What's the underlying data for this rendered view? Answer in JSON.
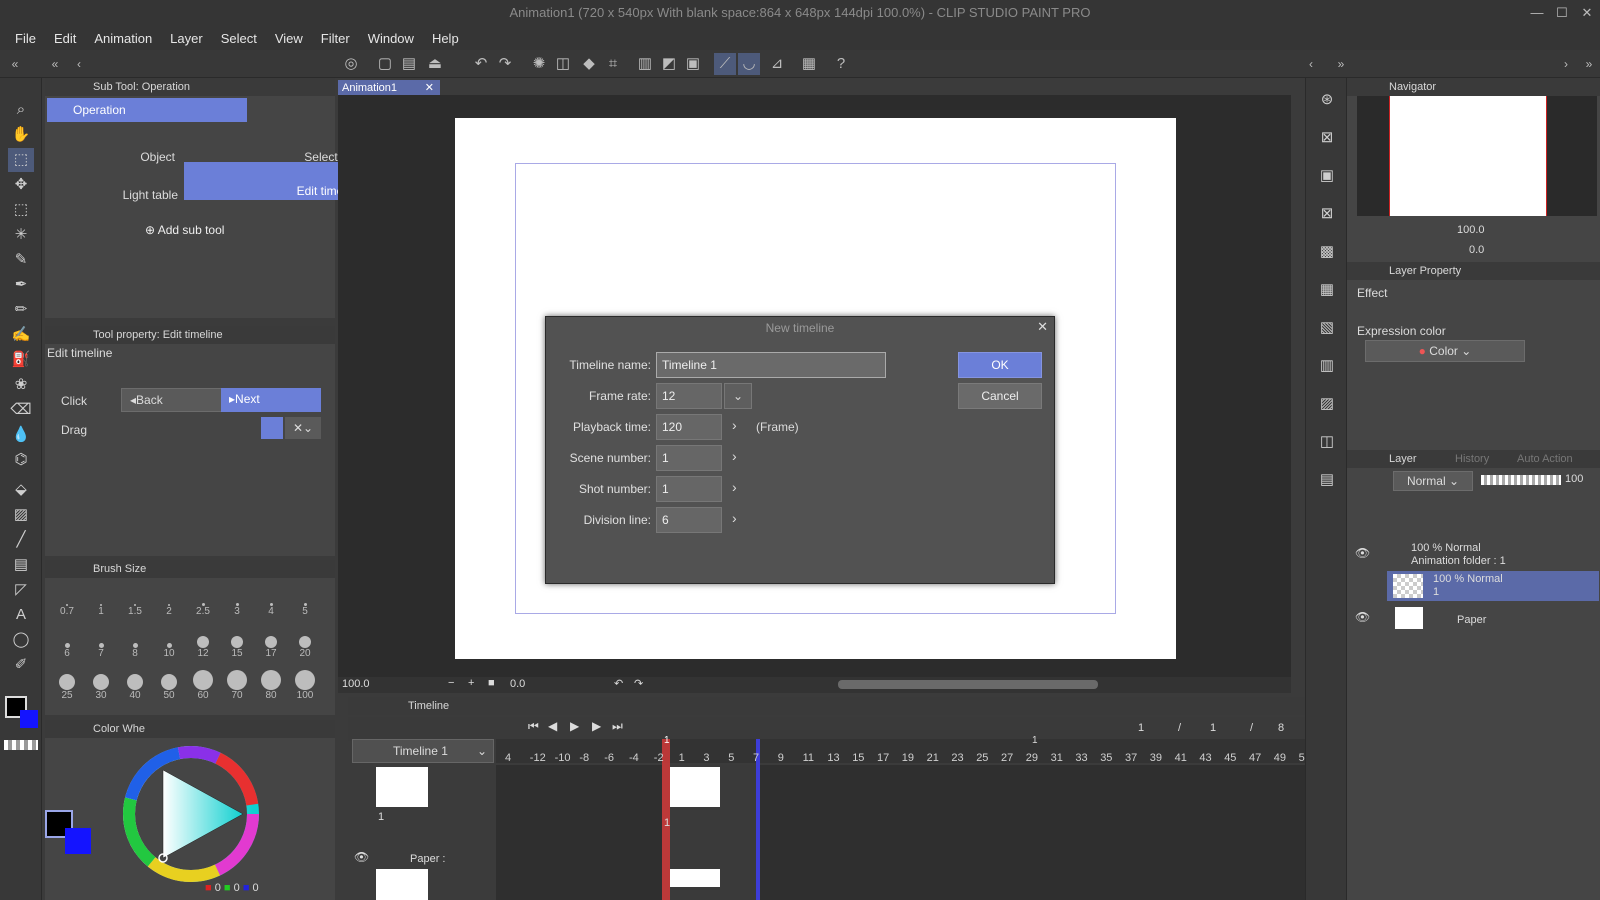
{
  "window": {
    "title": "Animation1 (720 x 540px With blank space:864 x 648px 144dpi 100.0%)  - CLIP STUDIO PAINT PRO",
    "minimize": "—",
    "maximize": "☐",
    "close": "✕"
  },
  "menu": [
    "File",
    "Edit",
    "Animation",
    "Layer",
    "Select",
    "View",
    "Filter",
    "Window",
    "Help"
  ],
  "subtool": {
    "header": "Sub Tool: Operation",
    "group_tab": "Operation",
    "items": [
      "Object",
      "Select layer",
      "Light table",
      "Edit timeline"
    ],
    "add_label": "Add sub tool"
  },
  "tool_property": {
    "header": "Tool property: Edit timeline",
    "name": "Edit timeline",
    "click_label": "Click",
    "back_label": "Back",
    "next_label": "Next",
    "drag_label": "Drag"
  },
  "brush_size": {
    "header": "Brush Size",
    "rows": [
      [
        "0.7",
        "1",
        "1.5",
        "2",
        "2.5",
        "3",
        "4",
        "5"
      ],
      [
        "6",
        "7",
        "8",
        "10",
        "12",
        "15",
        "17",
        "20"
      ],
      [
        "25",
        "30",
        "40",
        "50",
        "60",
        "70",
        "80",
        "100"
      ]
    ]
  },
  "color_wheel": {
    "header": "Color Whe",
    "r": "0",
    "g": "0",
    "b": "0"
  },
  "canvas": {
    "tab": "Animation1",
    "zoom": "100.0",
    "rotation": "0.0"
  },
  "dialog": {
    "title": "New timeline",
    "fields": {
      "timeline_name_label": "Timeline name:",
      "timeline_name": "Timeline 1",
      "frame_rate_label": "Frame rate:",
      "frame_rate": "12",
      "playback_label": "Playback time:",
      "playback": "120",
      "playback_unit": "(Frame)",
      "scene_label": "Scene number:",
      "scene": "1",
      "shot_label": "Shot number:",
      "shot": "1",
      "division_label": "Division line:",
      "division": "6"
    },
    "ok": "OK",
    "cancel": "Cancel"
  },
  "navigator": {
    "header": "Navigator",
    "zoom": "100.0",
    "angle": "0.0"
  },
  "layer_property": {
    "header": "Layer Property",
    "effect_label": "Effect",
    "expression_label": "Expression color",
    "expression_value": "Color"
  },
  "layer_panel": {
    "tabs": [
      "Layer",
      "History",
      "Auto Action"
    ],
    "blend": "Normal",
    "opacity": "100",
    "layers": [
      {
        "line1": "100 % Normal",
        "line2": "Animation folder : 1"
      },
      {
        "line1": "100 % Normal",
        "line2": "1"
      },
      {
        "line1": "Paper",
        "line2": ""
      }
    ]
  },
  "timeline": {
    "header": "Timeline",
    "selector": "Timeline 1",
    "counter": [
      "1",
      "/",
      "1",
      "/",
      "8"
    ],
    "ruler": [
      "4",
      "-12",
      "-10",
      "-8",
      "-6",
      "-4",
      "-2",
      "1",
      "3",
      "5",
      "7",
      "9",
      "11",
      "13",
      "15",
      "17",
      "19",
      "21",
      "23",
      "25",
      "27",
      "29",
      "31",
      "33",
      "35",
      "37",
      "39",
      "41",
      "43",
      "45",
      "47",
      "49",
      "5"
    ],
    "marker_top": "1",
    "marker_31": "1",
    "track1_label": "1",
    "track1_cel": "1",
    "paper_label": "Paper :"
  },
  "colors": {
    "accent": "#6b7fd8",
    "dialog_bg": "#525252",
    "app_bg": "#3b3b3b",
    "playhead": "#d33a3a",
    "fg_color": "#000000",
    "bg_color": "#1414ff"
  }
}
